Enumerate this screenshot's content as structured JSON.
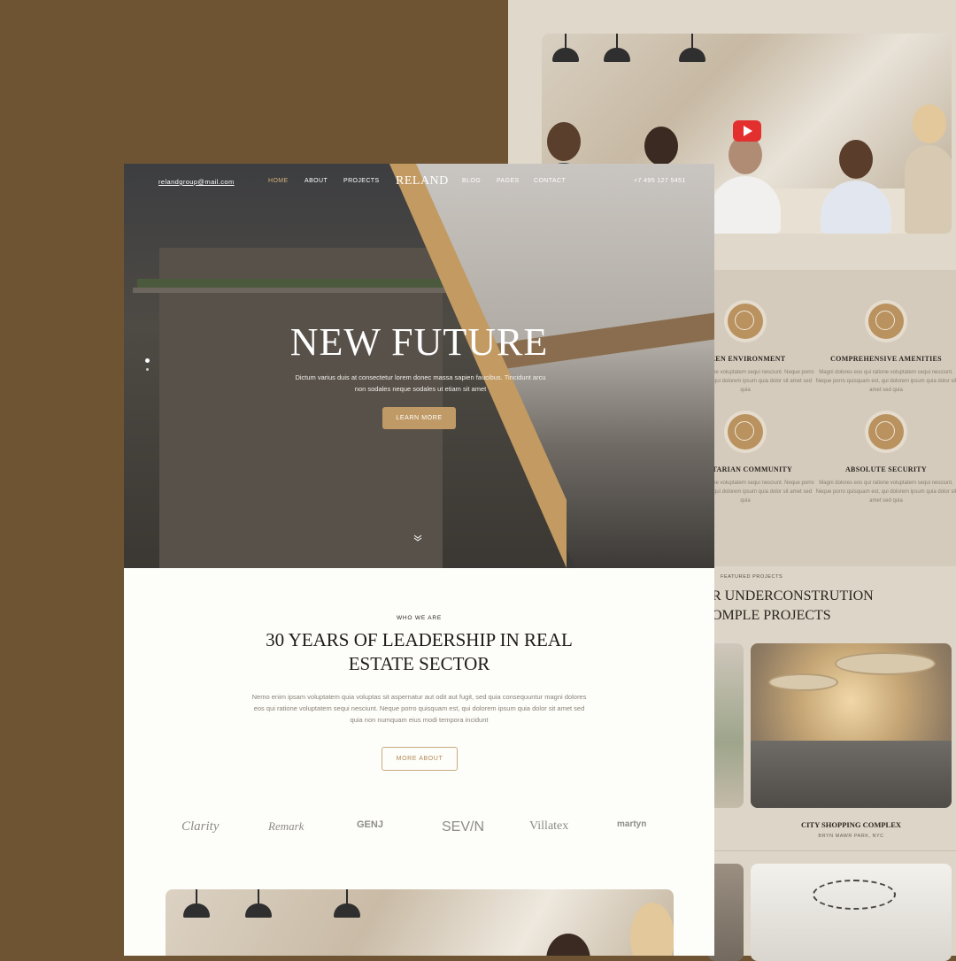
{
  "nav": {
    "email": "relandgroup@mail.com",
    "links": [
      "HOME",
      "ABOUT",
      "PROJECTS",
      "BLOG",
      "PAGES",
      "CONTACT"
    ],
    "logo": "RELAND",
    "phone": "+7 495 127 5451"
  },
  "hero": {
    "title": "NEW FUTURE",
    "subtitle": "Dictum varius duis at consectetur lorem donec massa sapien faucibus. Tincidunt arcu non sodales neque sodales ut etiam sit amet",
    "button": "LEARN MORE"
  },
  "about": {
    "eyebrow": "WHO WE ARE",
    "title": "30 YEARS OF LEADERSHIP IN REAL ESTATE SECTOR",
    "text": "Nemo enim ipsam voluptatem quia voluptas sit aspernatur aut odit aut fugit, sed quia consequuntur magni dolores eos qui ratione voluptatem sequi nesciunt. Neque porro quisquam est, qui dolorem ipsum quia dolor sit amet sed quia non numquam eius modi tempora incidunt",
    "button": "MORE ABOUT"
  },
  "brands": [
    "Clarity",
    "Remark",
    "GENJ",
    "SEV/N",
    "Villatex",
    "martyn"
  ],
  "features": [
    {
      "title": "REEN ENVIRONMENT",
      "text": "es eos qui ratione voluptatem sequi nesciunt. Neque porro quisquam est, qui dolorem ipsum quia dolor sit amet sed quia",
      "icon": "leaf-hand-icon"
    },
    {
      "title": "COMPREHENSIVE AMENITIES",
      "text": "Magni dolores eos qui ratione voluptatem sequi nesciunt. Neque porro quisquam est, qui dolorem ipsum quia dolor sit amet sed quia",
      "icon": "key-icon"
    },
    {
      "title": "ANITARIAN COMMUNITY",
      "text": "es eos qui ratione voluptatem sequi nesciunt. Neque porro quisquam est, qui dolorem ipsum quia dolor sit amet sed quia",
      "icon": "people-icon"
    },
    {
      "title": "ABSOLUTE SECURITY",
      "text": "Magni dolores eos qui ratione voluptatem sequi nesciunt. Neque porro quisquam est, qui dolorem ipsum quia dolor sit amet sed quia",
      "icon": "lock-shield-icon"
    }
  ],
  "projects": {
    "eyebrow": "FEATURED PROJECTS",
    "title_line1": "R UNDERCONSTRUTION",
    "title_line2": "OMPLE PROJECTS",
    "card_title": "CITY SHOPPING COMPLEX",
    "card_location": "BRYN MAWR PARK, NYC"
  },
  "colors": {
    "accent": "#c09a66",
    "background_outer": "#6e5432",
    "back_page": "#e0d8cb"
  }
}
